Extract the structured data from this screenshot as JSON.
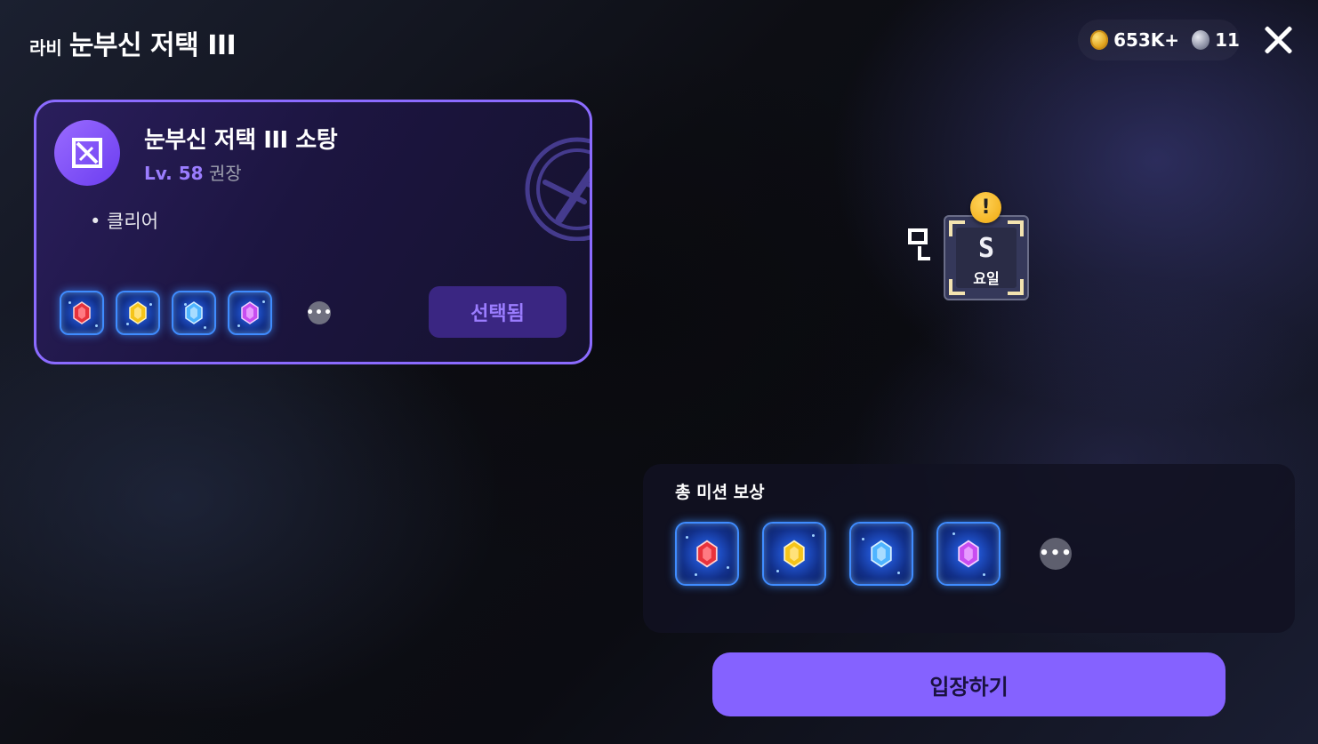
{
  "header": {
    "subtitle": "라비",
    "title": "눈부신 저택 III",
    "currency": [
      {
        "icon": "gold-coin-icon",
        "amount": "653K+"
      },
      {
        "icon": "silver-coin-icon",
        "amount": "11"
      }
    ]
  },
  "card": {
    "title": "눈부신 저택 III 소탕",
    "level_label": "Lv. 58",
    "level_class": "권장",
    "bullet": "• 클리어",
    "selected_label": "선택됨",
    "gems": [
      "red",
      "yellow",
      "blue",
      "purple"
    ],
    "more": "•••"
  },
  "status_widget": {
    "side_mark": "Ȫ",
    "value": "S",
    "label": "요일",
    "alert": "!"
  },
  "rewards": {
    "title": "총 미션 보상",
    "gems": [
      "red",
      "yellow",
      "blue",
      "purple"
    ],
    "more": "•••"
  },
  "enter_button": "입장하기",
  "colors": {
    "accent": "#8562ff",
    "card_border": "#8b6bff",
    "level_text": "#9b7dff",
    "gem_red": "#e8323c",
    "gem_yellow": "#f5c419",
    "gem_blue": "#4fb4ff",
    "gem_purple": "#c84df0"
  }
}
